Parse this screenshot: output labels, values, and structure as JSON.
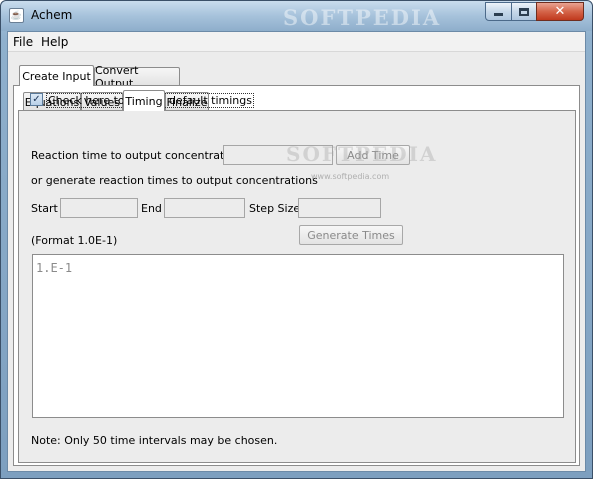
{
  "window": {
    "title": "Achem",
    "watermark": "SOFTPEDIA",
    "icon": "java-cup-icon"
  },
  "menu": {
    "file": "File",
    "help": "Help"
  },
  "top_tabs": [
    {
      "label": "Create Input",
      "active": true
    },
    {
      "label": "Convert Output",
      "active": false
    }
  ],
  "sub_tabs": [
    {
      "label": "Equations",
      "active": false
    },
    {
      "label": "Values",
      "active": false
    },
    {
      "label": "Timing",
      "active": true
    },
    {
      "label": "Finalize",
      "active": false
    }
  ],
  "timing": {
    "default_checkbox_label": "Check here to enable default timings",
    "default_checked": true,
    "reaction_time_label": "Reaction time to output concentrations",
    "reaction_time_value": "",
    "add_time_label": "Add Time",
    "generate_label": "or generate reaction times to output concentrations",
    "start_label": "Start",
    "start_value": "",
    "end_label": "End",
    "end_value": "",
    "step_label": "Step Size",
    "step_value": "",
    "format_label": "(Format 1.0E-1)",
    "generate_button": "Generate Times",
    "times_text": "1.E-1",
    "note": "Note: Only 50 time intervals may be chosen."
  },
  "content_watermark": "SOFTPEDIA",
  "content_watermark_url": "www.softpedia.com"
}
